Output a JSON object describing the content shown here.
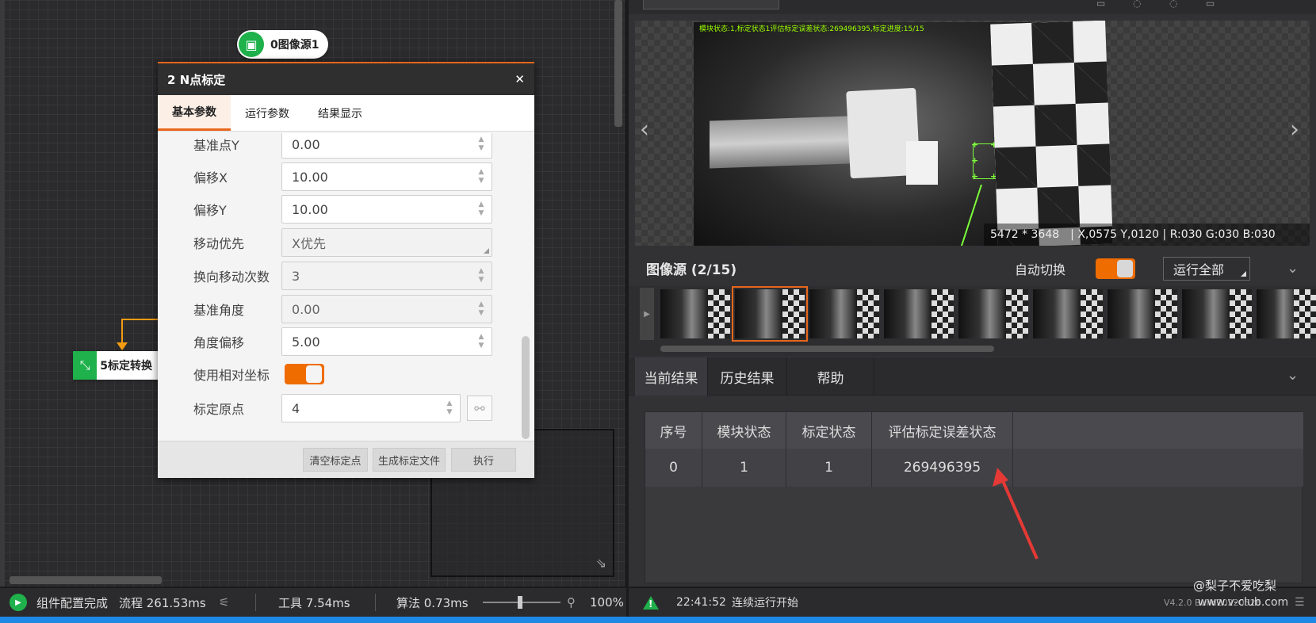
{
  "canvas": {
    "node_source": "0图像源1",
    "node_transform": "5标定转换"
  },
  "dialog": {
    "title": "2 N点标定",
    "close": "✕",
    "tabs": [
      "基本参数",
      "运行参数",
      "结果显示"
    ],
    "params": {
      "base_y": {
        "label": "基准点Y",
        "value": "0.00"
      },
      "offset_x": {
        "label": "偏移X",
        "value": "10.00"
      },
      "offset_y": {
        "label": "偏移Y",
        "value": "10.00"
      },
      "move_priority": {
        "label": "移动优先",
        "value": "X优先"
      },
      "reverse_count": {
        "label": "换向移动次数",
        "value": "3"
      },
      "base_angle": {
        "label": "基准角度",
        "value": "0.00"
      },
      "angle_offset": {
        "label": "角度偏移",
        "value": "5.00"
      },
      "relative_coord": {
        "label": "使用相对坐标",
        "on": true
      },
      "origin": {
        "label": "标定原点",
        "value": "4"
      }
    },
    "buttons": {
      "clear": "清空标定点",
      "generate": "生成标定文件",
      "execute": "执行"
    }
  },
  "viewer": {
    "overlay": "模块状态:1,标定状态1评估标定误差状态:269496395,标定进度:15/15",
    "resolution": "5472 * 3648",
    "coords": "| X,0575  Y,0120  |  R:030  G:030  B:030"
  },
  "source_bar": {
    "title": "图像源 (2/15)",
    "auto_switch": "自动切换",
    "auto_on": true,
    "run_all": "运行全部"
  },
  "thumbnails": {
    "count": 9,
    "selected_index": 1
  },
  "results": {
    "tabs": [
      "当前结果",
      "历史结果",
      "帮助"
    ],
    "columns": [
      "序号",
      "模块状态",
      "标定状态",
      "评估标定误差状态"
    ],
    "rows": [
      [
        "0",
        "1",
        "1",
        "269496395"
      ]
    ]
  },
  "status_left": {
    "config_done": "组件配置完成",
    "flow": "流程  261.53ms",
    "tool": "工具  7.54ms",
    "algo": "算法  0.73ms",
    "zoom": "100%"
  },
  "status_right": {
    "time": "22:41:52",
    "msg": "连续运行开始",
    "version": "V4.2.0 Build20220526"
  },
  "watermark": {
    "line1": "@梨子不爱吃梨",
    "line2": "www.v-club.com"
  },
  "colors": {
    "accent": "#e8661b",
    "node_green": "#1fb14b",
    "overlay_green": "#9cff00"
  }
}
